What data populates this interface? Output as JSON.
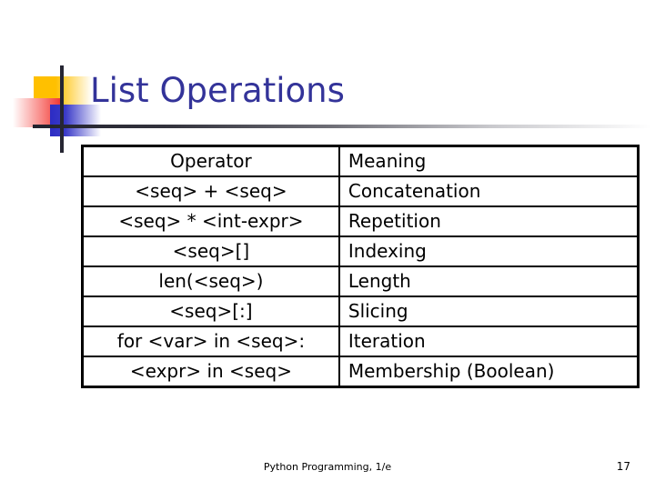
{
  "slide": {
    "title": "List Operations",
    "title_color": "#333399"
  },
  "decoration": {
    "yellow_square": "yellow-gradient-square",
    "red_square": "red-gradient-square",
    "blue_square": "blue-gradient-square",
    "vertical_rule": "vertical-rule",
    "horizontal_rule": "horizontal-rule-gradient",
    "colors": {
      "yellow": "#FFC000",
      "red": "#F03A36",
      "blue": "#2C2CC4",
      "rule": "#262633"
    }
  },
  "table": {
    "headers": [
      "Operator",
      "Meaning"
    ],
    "rows": [
      [
        "<seq> + <seq>",
        "Concatenation"
      ],
      [
        "<seq> * <int-expr>",
        "Repetition"
      ],
      [
        "<seq>[]",
        "Indexing"
      ],
      [
        "len(<seq>)",
        "Length"
      ],
      [
        "<seq>[:]",
        "Slicing"
      ],
      [
        "for <var> in <seq>:",
        "Iteration"
      ],
      [
        "<expr> in <seq>",
        "Membership (Boolean)"
      ]
    ]
  },
  "footer": {
    "note": "Python Programming, 1/e",
    "page_number": "17"
  }
}
